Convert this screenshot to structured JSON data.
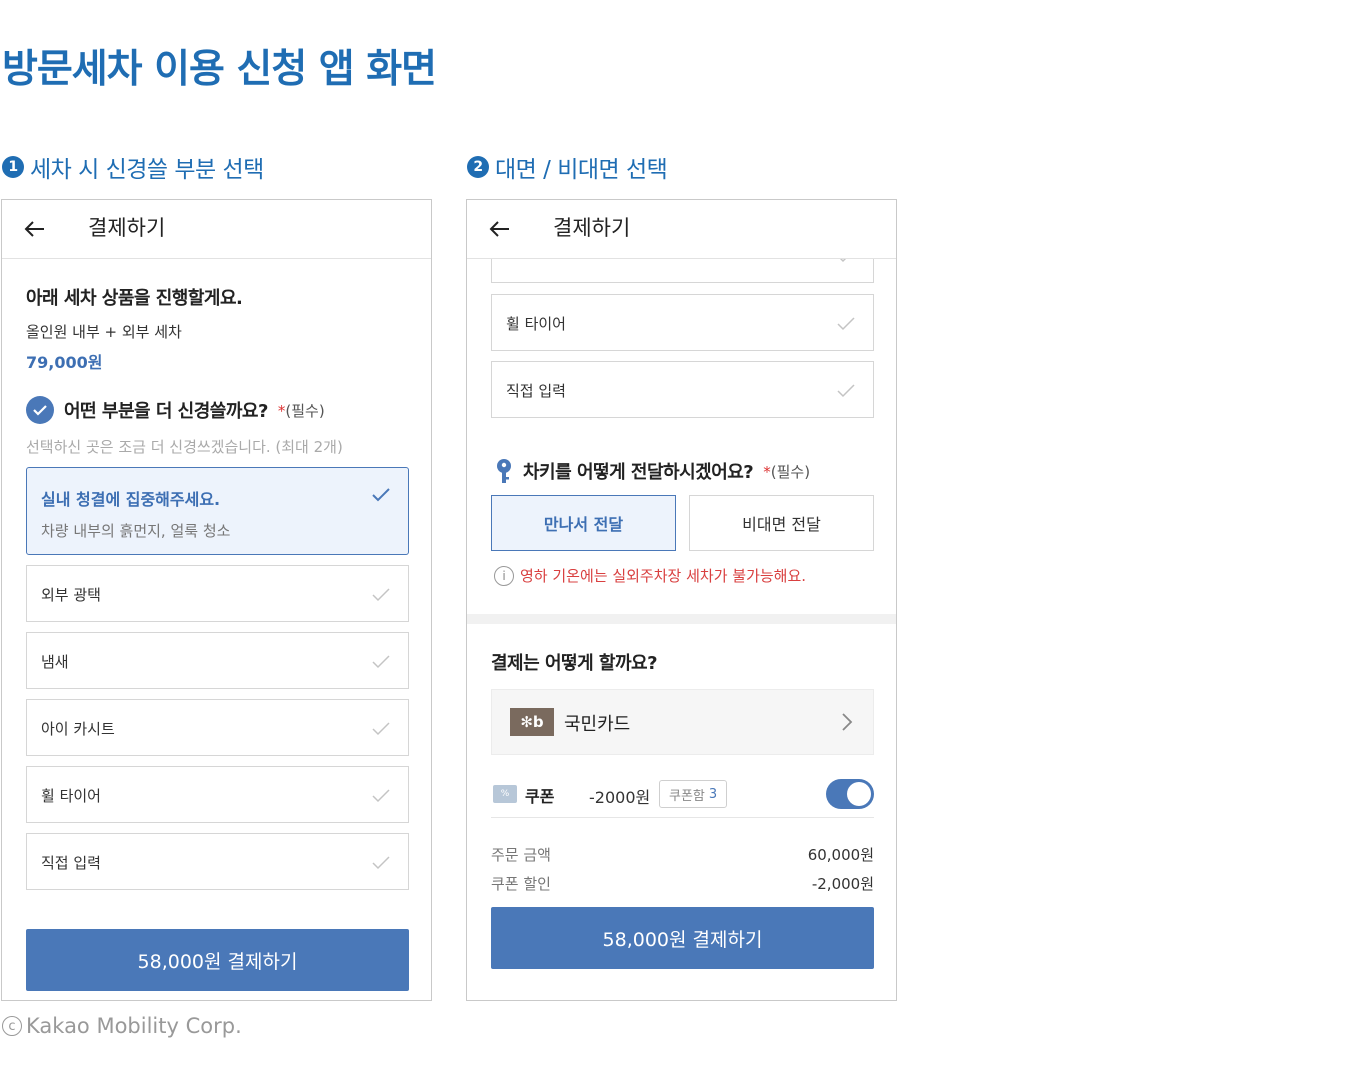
{
  "page_title": "방문세차 이용 신청 앱 화면",
  "sections": [
    {
      "num": "1",
      "title": "세차 시 신경쓸 부분 선택"
    },
    {
      "num": "2",
      "title": "대면 / 비대면 선택"
    }
  ],
  "screen1": {
    "header_title": "결제하기",
    "intro_heading": "아래 세차 상품을 진행할게요.",
    "product_name": "올인원 내부 + 외부 세차",
    "product_price": "79,000원",
    "question": "어떤 부분을 더 신경쓸까요?",
    "required_star": "*",
    "required_text": "(필수)",
    "hint": "선택하신 곳은 조금 더 신경쓰겠습니다. (최대 2개)",
    "selected_option": {
      "label": "실내 청결에 집중해주세요.",
      "sub": "차량 내부의 흙먼지, 얼룩 청소"
    },
    "options": [
      "외부 광택",
      "냄새",
      "아이 카시트",
      "휠 타이어",
      "직접 입력"
    ],
    "pay_button": "58,000원 결제하기"
  },
  "screen2": {
    "header_title": "결제하기",
    "options": [
      "휠 타이어",
      "직접 입력"
    ],
    "key_question": "차키를 어떻게 전달하시겠어요?",
    "required_star": "*",
    "required_text": "(필수)",
    "handover_options": [
      "만나서 전달",
      "비대면 전달"
    ],
    "selected_handover": "만나서 전달",
    "warning": "영하 기온에는 실외주차장 세차가 불가능해요.",
    "payment_heading": "결제는 어떻게 할까요?",
    "card_name": "국민카드",
    "coupon_label": "쿠폰",
    "coupon_amount": "-2000원",
    "coupon_box_label": "쿠폰함",
    "coupon_count": "3",
    "coupon_toggle_on": true,
    "summary": [
      {
        "label": "주문 금액",
        "value": "60,000원"
      },
      {
        "label": "쿠폰 할인",
        "value": "-2,000원"
      }
    ],
    "pay_button": "58,000원 결제하기"
  },
  "copyright": "Kakao Mobility Corp.",
  "colors": {
    "accent": "#4a78b8",
    "title_blue": "#1f6db3",
    "warning_red": "#d94040"
  }
}
